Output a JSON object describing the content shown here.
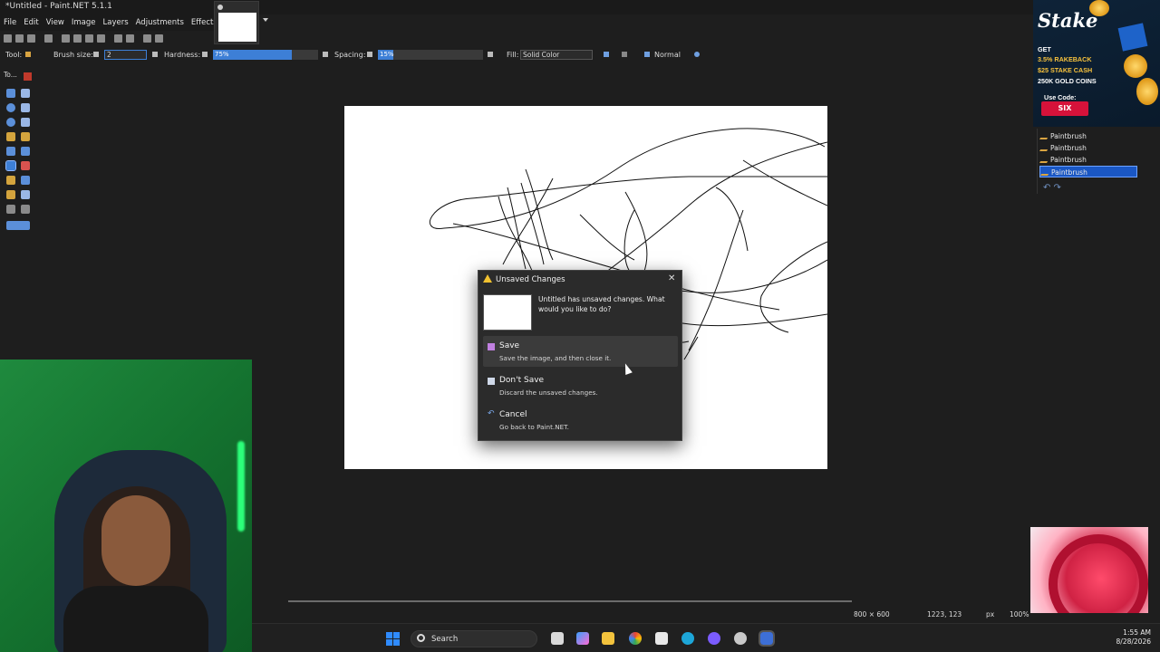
{
  "window": {
    "title": "*Untitled - Paint.NET 5.1.1"
  },
  "menu": [
    "File",
    "Edit",
    "View",
    "Image",
    "Layers",
    "Adjustments",
    "Effects"
  ],
  "options_bar": {
    "tool_label": "Tool:",
    "brush_size_label": "Brush size:",
    "brush_size_value": "2",
    "hardness_label": "Hardness:",
    "hardness_value": "75%",
    "hardness_fraction": 0.75,
    "spacing_label": "Spacing:",
    "spacing_value": "15%",
    "spacing_fraction": 0.15,
    "fill_label": "Fill:",
    "fill_value": "Solid Color",
    "blend_mode": "Normal"
  },
  "tools_panel": {
    "header": "To..."
  },
  "history": {
    "items": [
      "Paintbrush",
      "Paintbrush",
      "Paintbrush",
      "Paintbrush"
    ],
    "selected_index": 3
  },
  "dialog": {
    "title": "Unsaved Changes",
    "message": "Untitled has unsaved changes. What would you like to do?",
    "options": [
      {
        "title": "Save",
        "desc": "Save the image, and then close it."
      },
      {
        "title": "Don't Save",
        "desc": "Discard the unsaved changes."
      },
      {
        "title": "Cancel",
        "desc": "Go back to Paint.NET."
      }
    ]
  },
  "status_bar": {
    "image_size": "800 × 600",
    "cursor_pos": "1223, 123",
    "units": "px",
    "zoom": "100%"
  },
  "taskbar": {
    "search_placeholder": "Search",
    "time": "1:55 AM",
    "date": "8/28/2026"
  },
  "ad": {
    "brand": "Stake",
    "lines": [
      "GET",
      "3.5% RAKEBACK",
      "$25 STAKE CASH",
      "250K GOLD COINS",
      "Use Code:"
    ],
    "code": "SIX"
  },
  "colors": {
    "accent_blue": "#3d7fd6",
    "selection_blue": "#1a57c4",
    "warning_yellow": "#f2c230",
    "dialog_bg": "#2b2b2b",
    "canvas_bg": "#ffffff"
  }
}
